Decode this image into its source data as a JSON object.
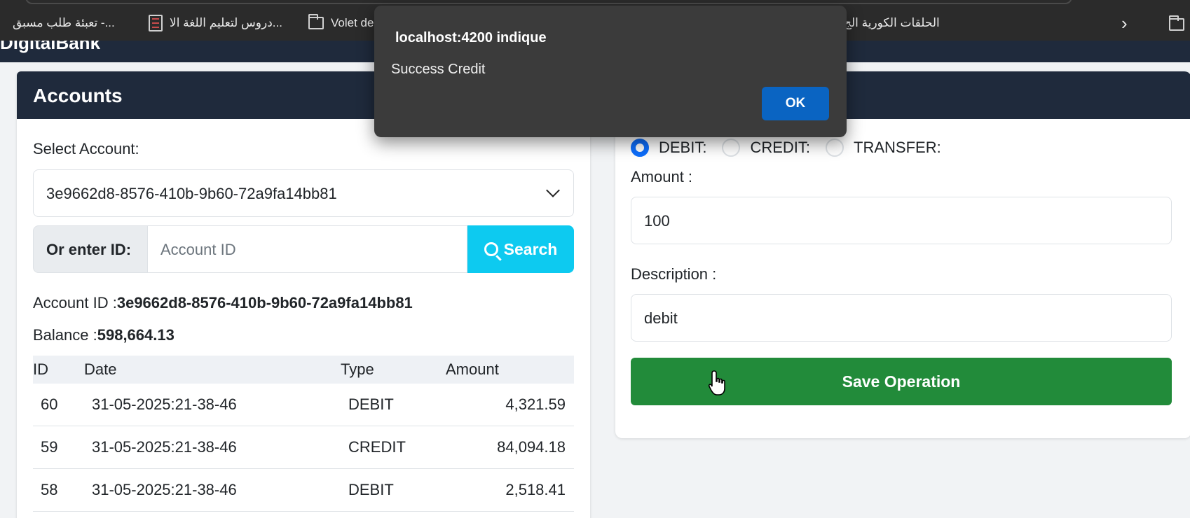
{
  "browser": {
    "bookmarks": [
      {
        "label": "تعبئة طلب مسبق -..."
      },
      {
        "label": "دروس لتعليم اللغة الا..."
      },
      {
        "label": "Volet de"
      },
      {
        "label": "الحلقات الكورية الج"
      }
    ],
    "overflow_icon": "chevron-right-icon",
    "other_bookmarks_icon": "folder-icon"
  },
  "app": {
    "brand": "DigitalBank"
  },
  "accounts": {
    "title": "Accounts",
    "select_label": "Select Account:",
    "selected_account": "3e9662d8-8576-410b-9b60-72a9fa14bb81",
    "or_enter_label": "Or enter ID:",
    "id_placeholder": "Account ID",
    "search_label": "Search",
    "account_id_label": "Account ID :",
    "account_id_value": "3e9662d8-8576-410b-9b60-72a9fa14bb81",
    "balance_label": "Balance :",
    "balance_value": "598,664.13",
    "table": {
      "headers": [
        "ID",
        "Date",
        "Type",
        "Amount"
      ],
      "rows": [
        {
          "id": "60",
          "date": "31-05-2025:21-38-46",
          "type": "DEBIT",
          "amount": "4,321.59"
        },
        {
          "id": "59",
          "date": "31-05-2025:21-38-46",
          "type": "CREDIT",
          "amount": "84,094.18"
        },
        {
          "id": "58",
          "date": "31-05-2025:21-38-46",
          "type": "DEBIT",
          "amount": "2,518.41"
        }
      ]
    }
  },
  "operations": {
    "radio_debit": "DEBIT:",
    "radio_credit": "CREDIT:",
    "radio_transfer": "TRANSFER:",
    "selected_operation": "DEBIT",
    "amount_label": "Amount :",
    "amount_value": "100",
    "description_label": "Description :",
    "description_value": "debit",
    "save_label": "Save Operation"
  },
  "dialog": {
    "title": "localhost:4200 indique",
    "message": "Success Credit",
    "ok_label": "OK"
  },
  "colors": {
    "header_bg": "#1f2a3c",
    "search_btn": "#0dcaf0",
    "save_btn": "#228b3a",
    "radio_active": "#0d6efd",
    "dialog_ok": "#0a64c2"
  }
}
